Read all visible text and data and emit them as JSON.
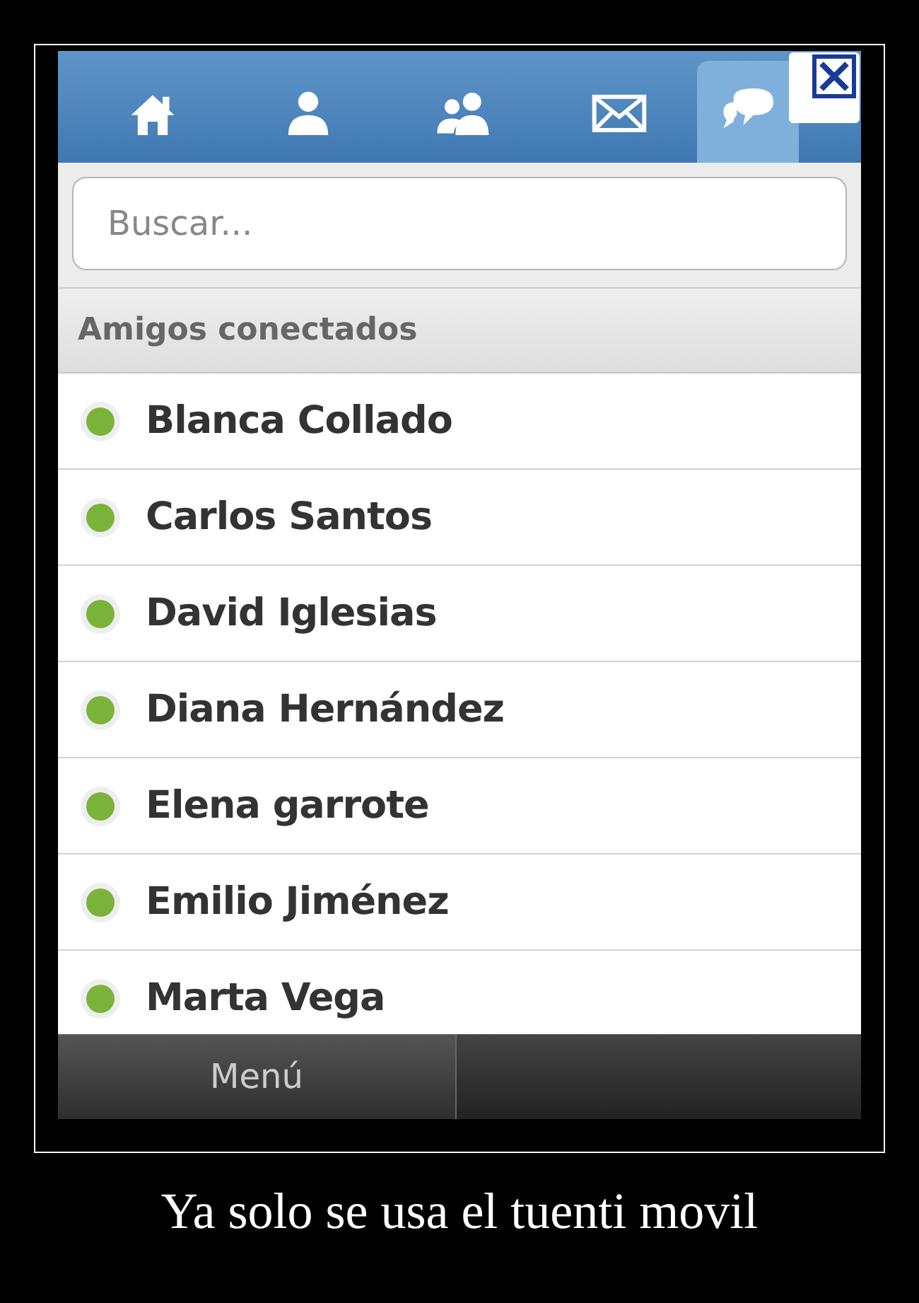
{
  "nav": {
    "tabs": [
      {
        "kind": "home",
        "selected": false
      },
      {
        "kind": "person",
        "selected": false
      },
      {
        "kind": "people",
        "selected": false
      },
      {
        "kind": "mail",
        "selected": false
      },
      {
        "kind": "chat",
        "selected": true
      }
    ]
  },
  "search": {
    "placeholder": "Buscar..."
  },
  "section": {
    "title": "Amigos conectados"
  },
  "friends": [
    {
      "name": "Blanca Collado",
      "online": true
    },
    {
      "name": "Carlos Santos",
      "online": true
    },
    {
      "name": "David Iglesias",
      "online": true
    },
    {
      "name": "Diana Hernández",
      "online": true
    },
    {
      "name": "Elena garrote",
      "online": true
    },
    {
      "name": "Emilio Jiménez",
      "online": true
    },
    {
      "name": "Marta Vega",
      "online": true
    }
  ],
  "bottom_bar": {
    "menu": "Menú"
  },
  "caption": "Ya solo se usa el tuenti movil"
}
